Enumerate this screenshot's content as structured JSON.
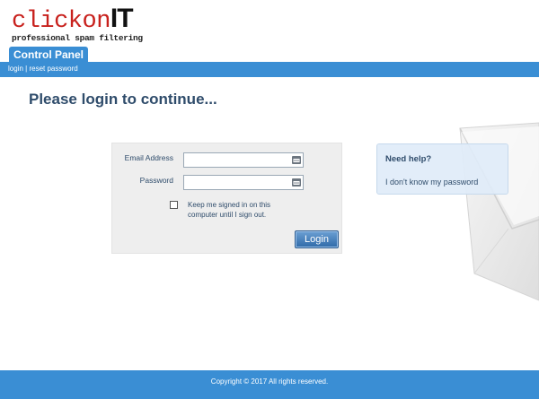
{
  "header": {
    "logo_main": "clickon",
    "logo_it": "IT",
    "logo_tagline": "professional spam filtering",
    "tab_label": "Control Panel"
  },
  "nav": {
    "login": "login",
    "separator": "|",
    "reset_password": "reset password"
  },
  "page": {
    "title": "Please login to continue..."
  },
  "login_form": {
    "email_label": "Email Address",
    "email_value": "",
    "password_label": "Password",
    "password_value": "",
    "keep_signed_in_label": "Keep me signed in on this computer until I sign out.",
    "keep_signed_in_checked": false,
    "login_button": "Login"
  },
  "help": {
    "title": "Need help?",
    "link": "I don't know my password"
  },
  "footer": {
    "copyright": "Copyright © 2017  All rights reserved."
  },
  "colors": {
    "brand_blue": "#3a8ed4",
    "title_navy": "#2f4c6b",
    "logo_red": "#c8211d"
  }
}
